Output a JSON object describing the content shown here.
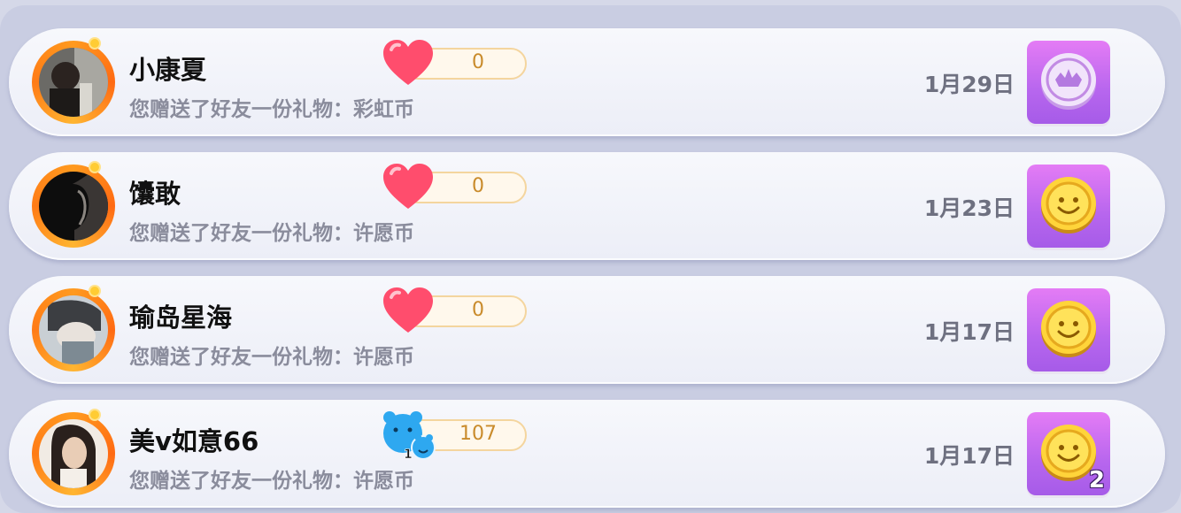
{
  "records": [
    {
      "name": "小康夏",
      "description": "您赠送了好友一份礼物：彩虹币",
      "score": "0",
      "score_icon": "heart-icon",
      "date": "1月29日",
      "gift_icon": "rainbow-coin-icon",
      "gift_count": ""
    },
    {
      "name": "馕敢",
      "description": "您赠送了好友一份礼物：许愿币",
      "score": "0",
      "score_icon": "heart-icon",
      "date": "1月23日",
      "gift_icon": "wish-coin-icon",
      "gift_count": ""
    },
    {
      "name": "瑜岛星海",
      "description": "您赠送了好友一份礼物：许愿币",
      "score": "0",
      "score_icon": "heart-icon",
      "date": "1月17日",
      "gift_icon": "wish-coin-icon",
      "gift_count": ""
    },
    {
      "name": "美v如意66",
      "description": "您赠送了好友一份礼物：许愿币",
      "score": "107",
      "score_icon": "bear-icon",
      "bear_badge": "1",
      "date": "1月17日",
      "gift_icon": "wish-coin-icon",
      "gift_count": "2"
    }
  ],
  "colors": {
    "accent_orange": "#ff8a1c",
    "gift_tile": "#c06cf0",
    "heart": "#ff4d6d",
    "bear": "#2ea8f0"
  }
}
